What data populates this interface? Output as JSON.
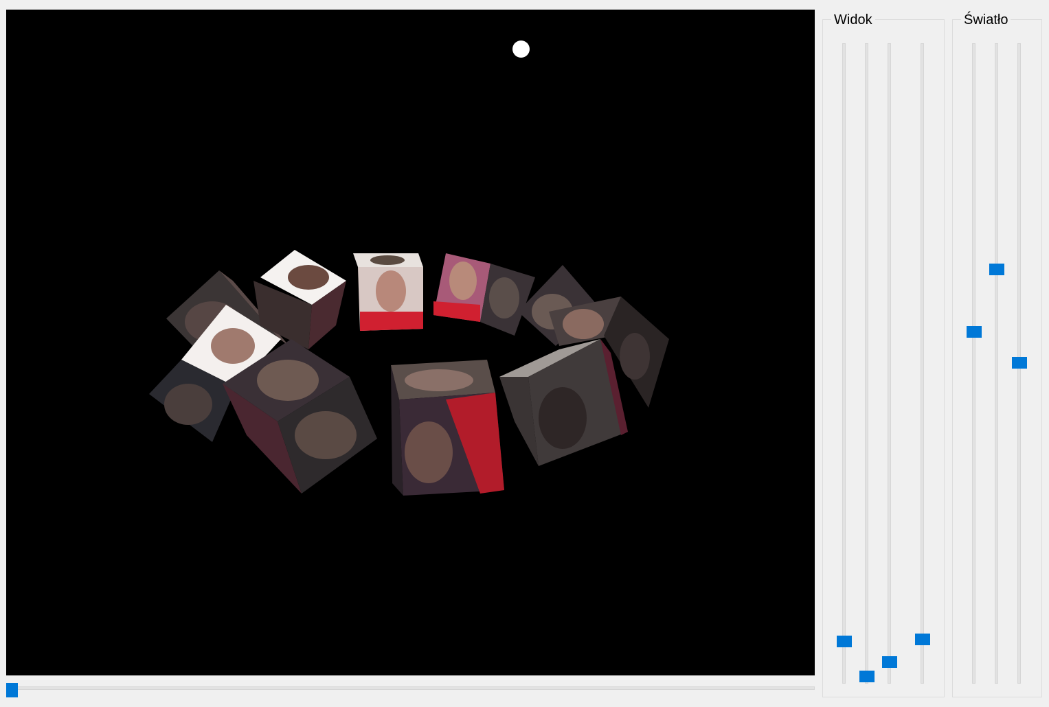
{
  "window": {
    "background": "#f0f0f0"
  },
  "viewport": {
    "background": "#000000",
    "light_color": "#ffffff"
  },
  "groups": {
    "widok": {
      "title": "Widok"
    },
    "swiatlo": {
      "title": "Światło"
    }
  },
  "sliders": {
    "accent": "#0078d7",
    "widok": [
      {
        "name": "widok-slider-1",
        "value": 0.07
      },
      {
        "name": "widok-slider-2",
        "value": 0.01
      },
      {
        "name": "widok-slider-3",
        "value": 0.03
      },
      {
        "name": "widok-slider-4",
        "value": 0.07
      }
    ],
    "swiatlo": [
      {
        "name": "swiatlo-slider-1",
        "value": 0.55
      },
      {
        "name": "swiatlo-slider-2",
        "value": 0.65
      },
      {
        "name": "swiatlo-slider-3",
        "value": 0.5
      }
    ],
    "timeline": {
      "name": "timeline-slider",
      "value": 0.0
    }
  }
}
